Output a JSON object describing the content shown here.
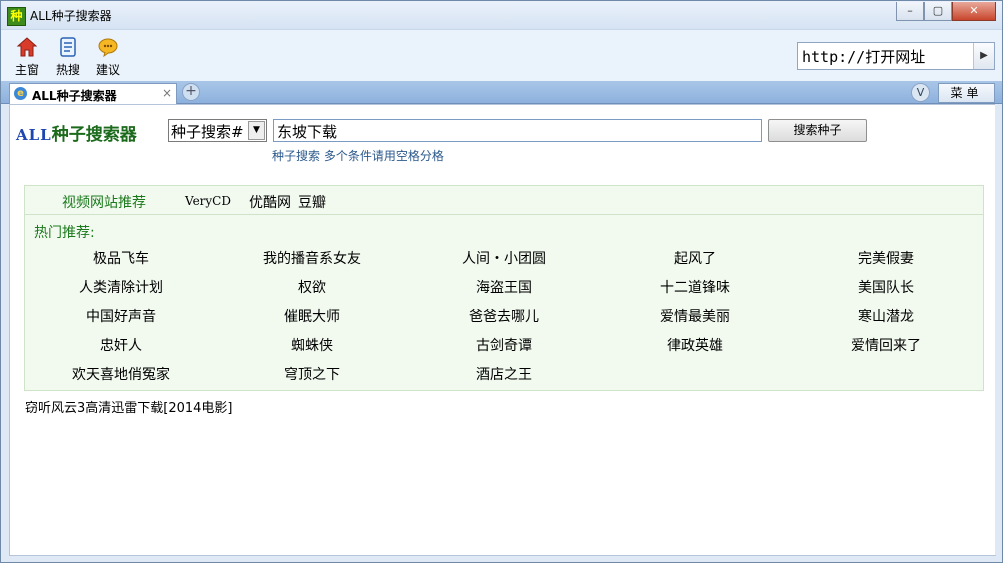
{
  "window": {
    "title": "ALL种子搜索器",
    "app_icon_glyph": "种",
    "minimize": "–",
    "maximize": "▢",
    "close": "✕"
  },
  "toolbar": {
    "buttons": [
      {
        "label": "主窗",
        "icon": "home-icon"
      },
      {
        "label": "热搜",
        "icon": "hot-search-icon"
      },
      {
        "label": "建议",
        "icon": "suggestion-icon"
      }
    ],
    "url": {
      "value": "http://打开网址",
      "go": "▶"
    }
  },
  "tabbar": {
    "active_tab": "ALL种子搜索器",
    "add": "+",
    "v": "V",
    "menu": "菜单"
  },
  "search": {
    "logo_prefix": "ALL",
    "logo_text": "种子搜索器",
    "select_value": "种子搜索#",
    "input_value": "东坡下载",
    "button": "搜索种子",
    "hint": "种子搜索 多个条件请用空格分格"
  },
  "video_sites": {
    "label": "视频网站推荐",
    "links": [
      "VeryCD",
      "优酷网",
      "豆瓣"
    ]
  },
  "hot": {
    "title": "热门推荐:",
    "rows": [
      [
        "极品飞车",
        "我的播音系女友",
        "人间・小团圆",
        "起风了",
        "完美假妻"
      ],
      [
        "人类清除计划",
        "权欲",
        "海盗王国",
        "十二道锋味",
        "美国队长"
      ],
      [
        "中国好声音",
        "催眠大师",
        "爸爸去哪儿",
        "爱情最美丽",
        "寒山潜龙"
      ],
      [
        "忠奸人",
        "蜘蛛侠",
        "古剑奇谭",
        "律政英雄",
        "爱情回来了"
      ],
      [
        "欢天喜地俏冤家",
        "穹顶之下",
        "酒店之王"
      ]
    ]
  },
  "footer": {
    "text": "窃听风云3高清迅雷下载[2014电影]"
  },
  "colors": {
    "accent_green": "#1c7a1c",
    "tab_blue": "#8db1dd",
    "close_red": "#c8452c"
  }
}
